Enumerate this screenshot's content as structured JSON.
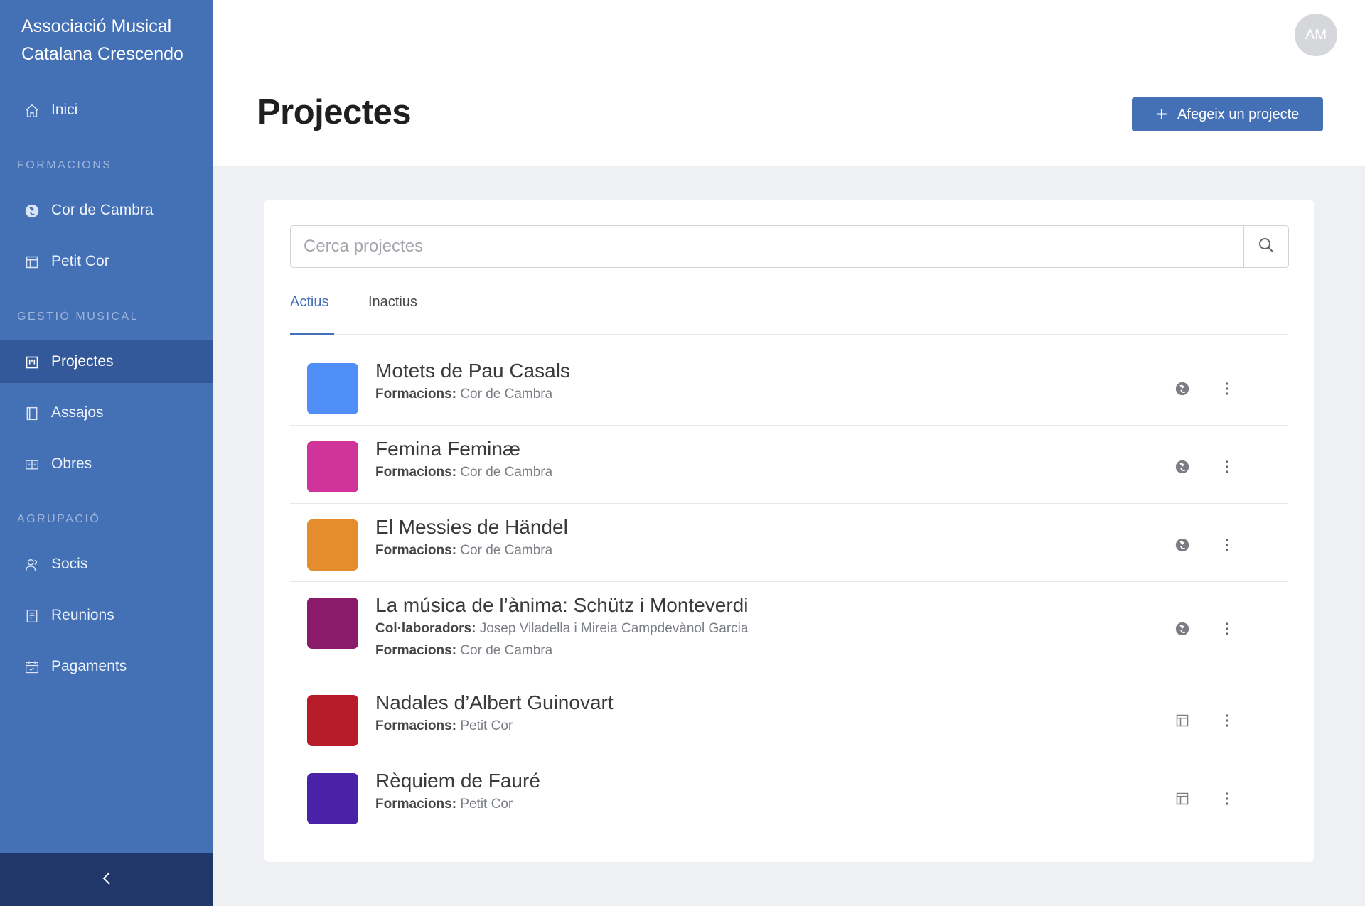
{
  "sidebar": {
    "brand": "Associació Musical Catalana Crescendo",
    "home": {
      "label": "Inici",
      "icon": "home-icon"
    },
    "sections": [
      {
        "label": "FORMACIONS"
      },
      {
        "label": "GESTIÓ MUSICAL"
      },
      {
        "label": "AGRUPACIÓ"
      }
    ],
    "formacions": [
      {
        "label": "Cor de Cambra",
        "icon": "choir-icon"
      },
      {
        "label": "Petit Cor",
        "icon": "layout-icon"
      }
    ],
    "gestio": [
      {
        "label": "Projectes",
        "icon": "board-icon",
        "active": true
      },
      {
        "label": "Assajos",
        "icon": "notebook-icon"
      },
      {
        "label": "Obres",
        "icon": "book-open-icon"
      }
    ],
    "agrupacio": [
      {
        "label": "Socis",
        "icon": "users-icon"
      },
      {
        "label": "Reunions",
        "icon": "document-icon"
      },
      {
        "label": "Pagaments",
        "icon": "calendar-check-icon"
      }
    ],
    "collapse_icon": "chevron-left-icon",
    "bg_color": "#4470b6",
    "active_color": "#34599a",
    "footer_color": "#21376a"
  },
  "header": {
    "avatar_initials": "AM",
    "title": "Projectes",
    "add_button_label": "Afegeix un projecte",
    "add_button_icon": "plus-icon"
  },
  "search": {
    "placeholder": "Cerca projectes",
    "value": "",
    "icon": "search-icon"
  },
  "tabs": [
    {
      "label": "Actius",
      "active": true
    },
    {
      "label": "Inactius",
      "active": false
    }
  ],
  "projects": [
    {
      "title": "Motets de Pau Casals",
      "color": "#4f8ef7",
      "formacions_key": "Formacions:",
      "formacions": "Cor de Cambra",
      "icon": "choir-icon"
    },
    {
      "title": "Femina Feminæ",
      "color": "#d0339a",
      "formacions_key": "Formacions:",
      "formacions": "Cor de Cambra",
      "icon": "choir-icon"
    },
    {
      "title": "El Messies de Händel",
      "color": "#e58c2c",
      "formacions_key": "Formacions:",
      "formacions": "Cor de Cambra",
      "icon": "choir-icon"
    },
    {
      "title": "La música de l’ànima: Schütz i Monteverdi",
      "color": "#8a1a6a",
      "collab_key": "Col·laboradors:",
      "collab": "Josep Viladella i Mireia Campdevànol Garcia",
      "formacions_key": "Formacions:",
      "formacions": "Cor de Cambra",
      "icon": "choir-icon"
    },
    {
      "title": "Nadales d’Albert Guinovart",
      "color": "#b51c28",
      "formacions_key": "Formacions:",
      "formacions": "Petit Cor",
      "icon": "layout-icon"
    },
    {
      "title": "Rèquiem de Fauré",
      "color": "#4a22a8",
      "formacions_key": "Formacions:",
      "formacions": "Petit Cor",
      "icon": "layout-icon"
    }
  ],
  "more_icon": "kebab-icon"
}
